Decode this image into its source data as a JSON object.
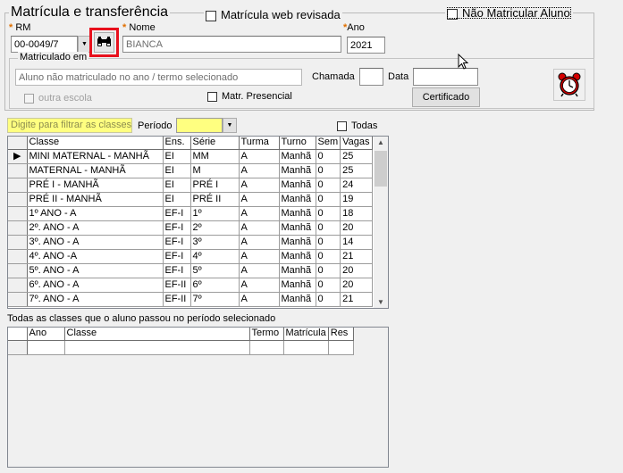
{
  "section": {
    "title": "Matrícula e transferência",
    "web_revisada_label": "Matrícula web revisada",
    "nao_matricular_label": "Não Matricular Aluno"
  },
  "rm": {
    "label": "RM",
    "value": "00-0049/7"
  },
  "nome": {
    "label": "Nome",
    "value": "BIANCA"
  },
  "ano": {
    "label": "Ano",
    "value": "2021"
  },
  "matriculado_em": {
    "title": "Matriculado em",
    "value": "Aluno não matriculado no ano / termo selecionado",
    "chamada_label": "Chamada",
    "chamada_value": "",
    "data_label": "Data",
    "data_value": "",
    "outra_escola_label": "outra escola",
    "matr_presencial_label": "Matr. Presencial",
    "certificado_label": "Certificado"
  },
  "filter": {
    "placeholder": "Digite para filtrar as classes",
    "periodo_label": "Período",
    "periodo_value": "",
    "todas_label": "Todas"
  },
  "classes_grid": {
    "columns": [
      "Classe",
      "Ens.",
      "Série",
      "Turma",
      "Turno",
      "Sem",
      "Vagas"
    ],
    "rows": [
      [
        "MINI MATERNAL - MANHÃ",
        "EI",
        "MM",
        "A",
        "Manhã",
        "0",
        "25"
      ],
      [
        "MATERNAL  - MANHÃ",
        "EI",
        "M",
        "A",
        "Manhã",
        "0",
        "25"
      ],
      [
        "PRÉ  I  - MANHÃ",
        "EI",
        "PRÉ I",
        "A",
        "Manhã",
        "0",
        "24"
      ],
      [
        "PRÉ  II  - MANHÃ",
        "EI",
        "PRÉ II",
        "A",
        "Manhã",
        "0",
        "19"
      ],
      [
        "1º ANO - A",
        "EF-I",
        "1º",
        "A",
        "Manhã",
        "0",
        "18"
      ],
      [
        "2º. ANO  - A",
        "EF-I",
        "2º",
        "A",
        "Manhã",
        "0",
        "20"
      ],
      [
        "3º. ANO  - A",
        "EF-I",
        "3º",
        "A",
        "Manhã",
        "0",
        "14"
      ],
      [
        "4º. ANO  -A",
        "EF-I",
        "4º",
        "A",
        "Manhã",
        "0",
        "21"
      ],
      [
        "5º. ANO  -  A",
        "EF-I",
        "5º",
        "A",
        "Manhã",
        "0",
        "20"
      ],
      [
        "6º. ANO  - A",
        "EF-II",
        "6º",
        "A",
        "Manhã",
        "0",
        "20"
      ],
      [
        "7º. ANO  - A",
        "EF-II",
        "7º",
        "A",
        "Manhã",
        "0",
        "21"
      ]
    ]
  },
  "history": {
    "caption": "Todas as classes que o aluno passou no período selecionado",
    "columns": [
      "Ano",
      "Classe",
      "Termo",
      "Matrícula",
      "Res"
    ]
  },
  "colors": {
    "highlight_red": "#e8101c",
    "filter_yellow": "#ffff80",
    "alarm_red": "#d40000"
  }
}
